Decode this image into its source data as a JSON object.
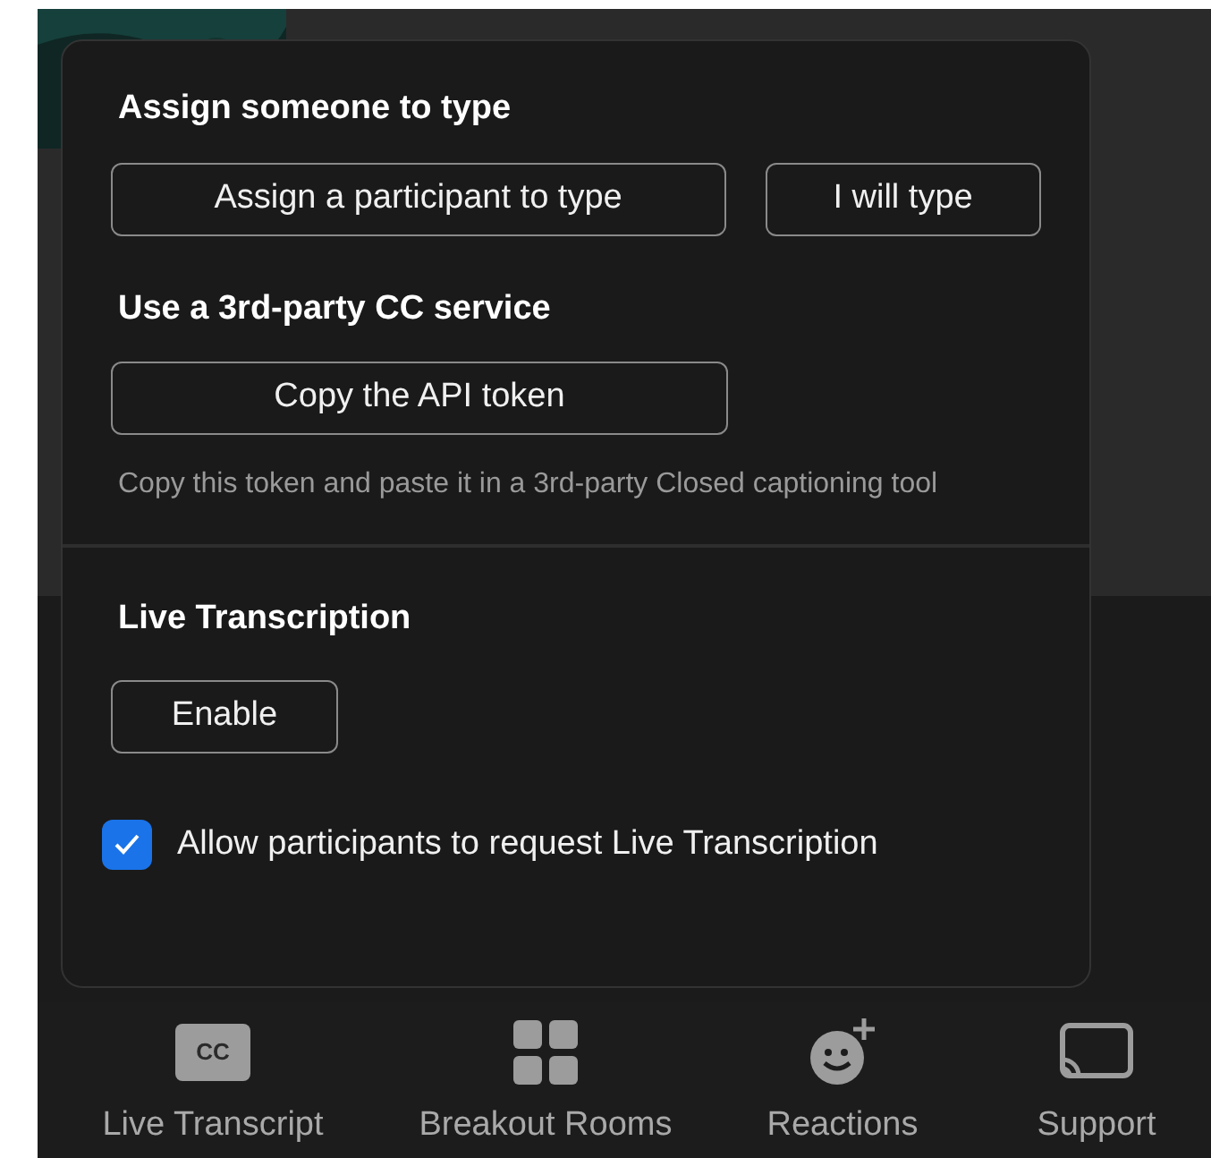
{
  "popup": {
    "sections": [
      {
        "heading": "Assign someone to type",
        "buttons": [
          "Assign a participant to type",
          "I will type"
        ]
      },
      {
        "heading": "Use a 3rd-party CC service",
        "buttons": [
          "Copy the API token"
        ],
        "description": "Copy this token and paste it in a 3rd-party Closed captioning tool"
      },
      {
        "heading": "Live Transcription",
        "buttons": [
          "Enable"
        ],
        "checkbox": {
          "label": "Allow participants to request Live Transcription",
          "checked": true
        }
      }
    ]
  },
  "toolbar": [
    {
      "kind": "cc",
      "icon_text": "CC",
      "label": "Live Transcript"
    },
    {
      "kind": "grid",
      "label": "Breakout Rooms"
    },
    {
      "kind": "reactions",
      "label": "Reactions"
    },
    {
      "kind": "cast",
      "label": "Support"
    }
  ]
}
